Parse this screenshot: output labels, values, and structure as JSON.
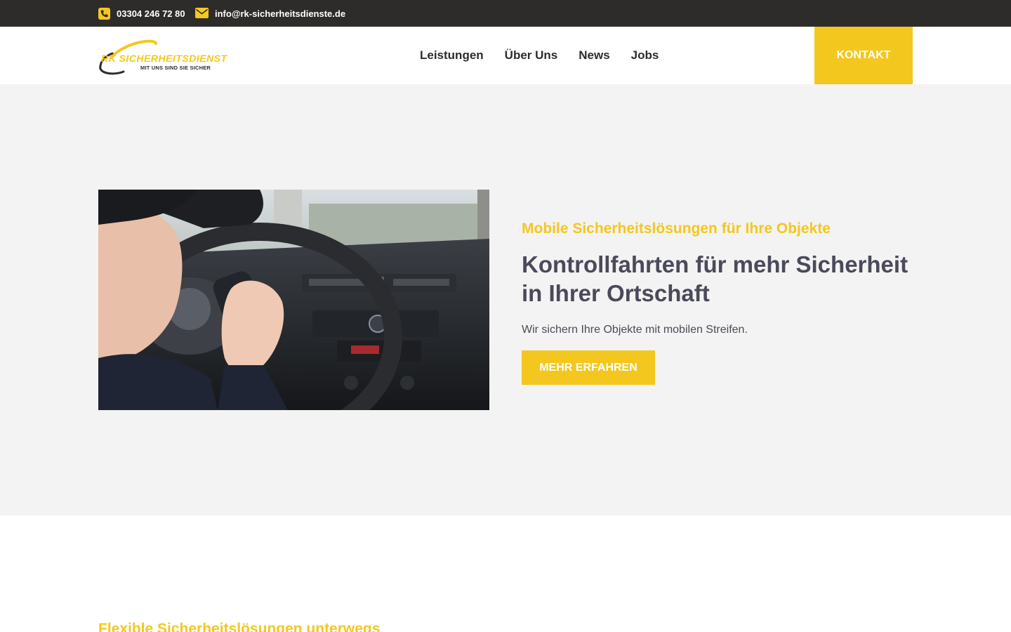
{
  "topbar": {
    "phone": "03304 246 72 80",
    "email": "info@rk-sicherheitsdienste.de"
  },
  "header": {
    "logo_main": "RK SICHERHEITSDIENST",
    "logo_sub": "MIT UNS SIND SIE SICHER",
    "nav": [
      {
        "label": "Leistungen"
      },
      {
        "label": "Über Uns"
      },
      {
        "label": "News"
      },
      {
        "label": "Jobs"
      }
    ],
    "contact_label": "KONTAKT"
  },
  "hero": {
    "kicker": "Mobile Sicherheitslösungen für Ihre Objekte",
    "headline": "Kontrollfahrten für mehr Sicherheit in Ihrer Ortschaft",
    "lead": "Wir sichern Ihre Objekte mit mobilen Streifen.",
    "cta_label": "MEHR ERFAHREN"
  },
  "next_section": {
    "title": "Flexible Sicherheitslösungen unterwegs"
  },
  "colors": {
    "accent": "#f4c71f",
    "topbar": "#2d2c2b",
    "text": "#4a4a5a",
    "hero_bg": "#f3f3f3"
  }
}
